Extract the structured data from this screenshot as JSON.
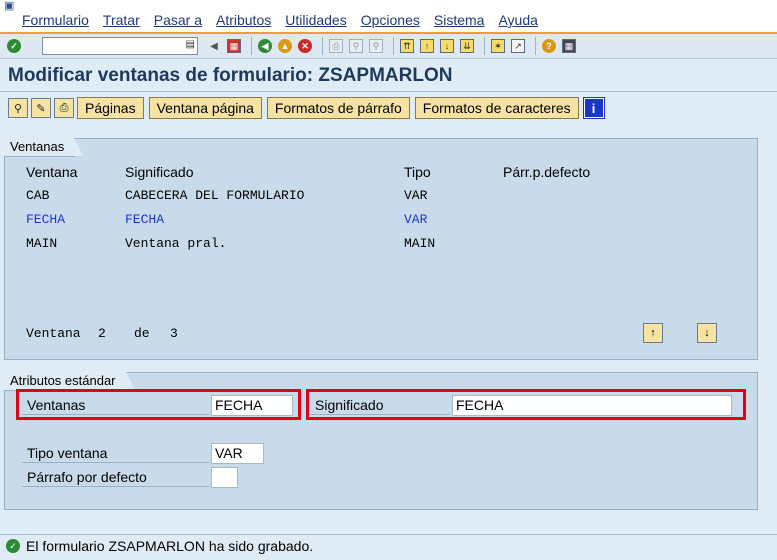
{
  "menu": {
    "items": [
      "Formulario",
      "Tratar",
      "Pasar a",
      "Atributos",
      "Utilidades",
      "Opciones",
      "Sistema",
      "Ayuda"
    ]
  },
  "toolbar": {
    "command_value": ""
  },
  "page": {
    "title": "Modificar ventanas de formulario: ZSAPMARLON"
  },
  "app_toolbar": {
    "buttons": [
      "Páginas",
      "Ventana página",
      "Formatos de párrafo",
      "Formatos de caracteres"
    ]
  },
  "ventanas": {
    "title": "Ventanas",
    "headers": [
      "Ventana",
      "Significado",
      "Tipo",
      "Párr.p.defecto"
    ],
    "rows": [
      {
        "ventana": "CAB",
        "significado": "CABECERA DEL FORMULARIO",
        "tipo": "VAR"
      },
      {
        "ventana": "FECHA",
        "significado": "FECHA",
        "tipo": "VAR"
      },
      {
        "ventana": "MAIN",
        "significado": "Ventana pral.",
        "tipo": "MAIN"
      }
    ],
    "pager": {
      "label": "Ventana",
      "current": "2",
      "of": "de",
      "total": "3"
    }
  },
  "atributos": {
    "title": "Atributos estándar",
    "ventanas_label": "Ventanas",
    "ventanas_value": "FECHA",
    "significado_label": "Significado",
    "significado_value": "FECHA",
    "tipo_label": "Tipo ventana",
    "tipo_value": "VAR",
    "parrafo_label": "Párrafo por defecto",
    "parrafo_value": ""
  },
  "status": {
    "message": "El formulario ZSAPMARLON ha sido grabado."
  },
  "colors": {
    "accent": "#e8a23a",
    "highlight": "#e0001a",
    "link_blue": "#1d35d6"
  }
}
